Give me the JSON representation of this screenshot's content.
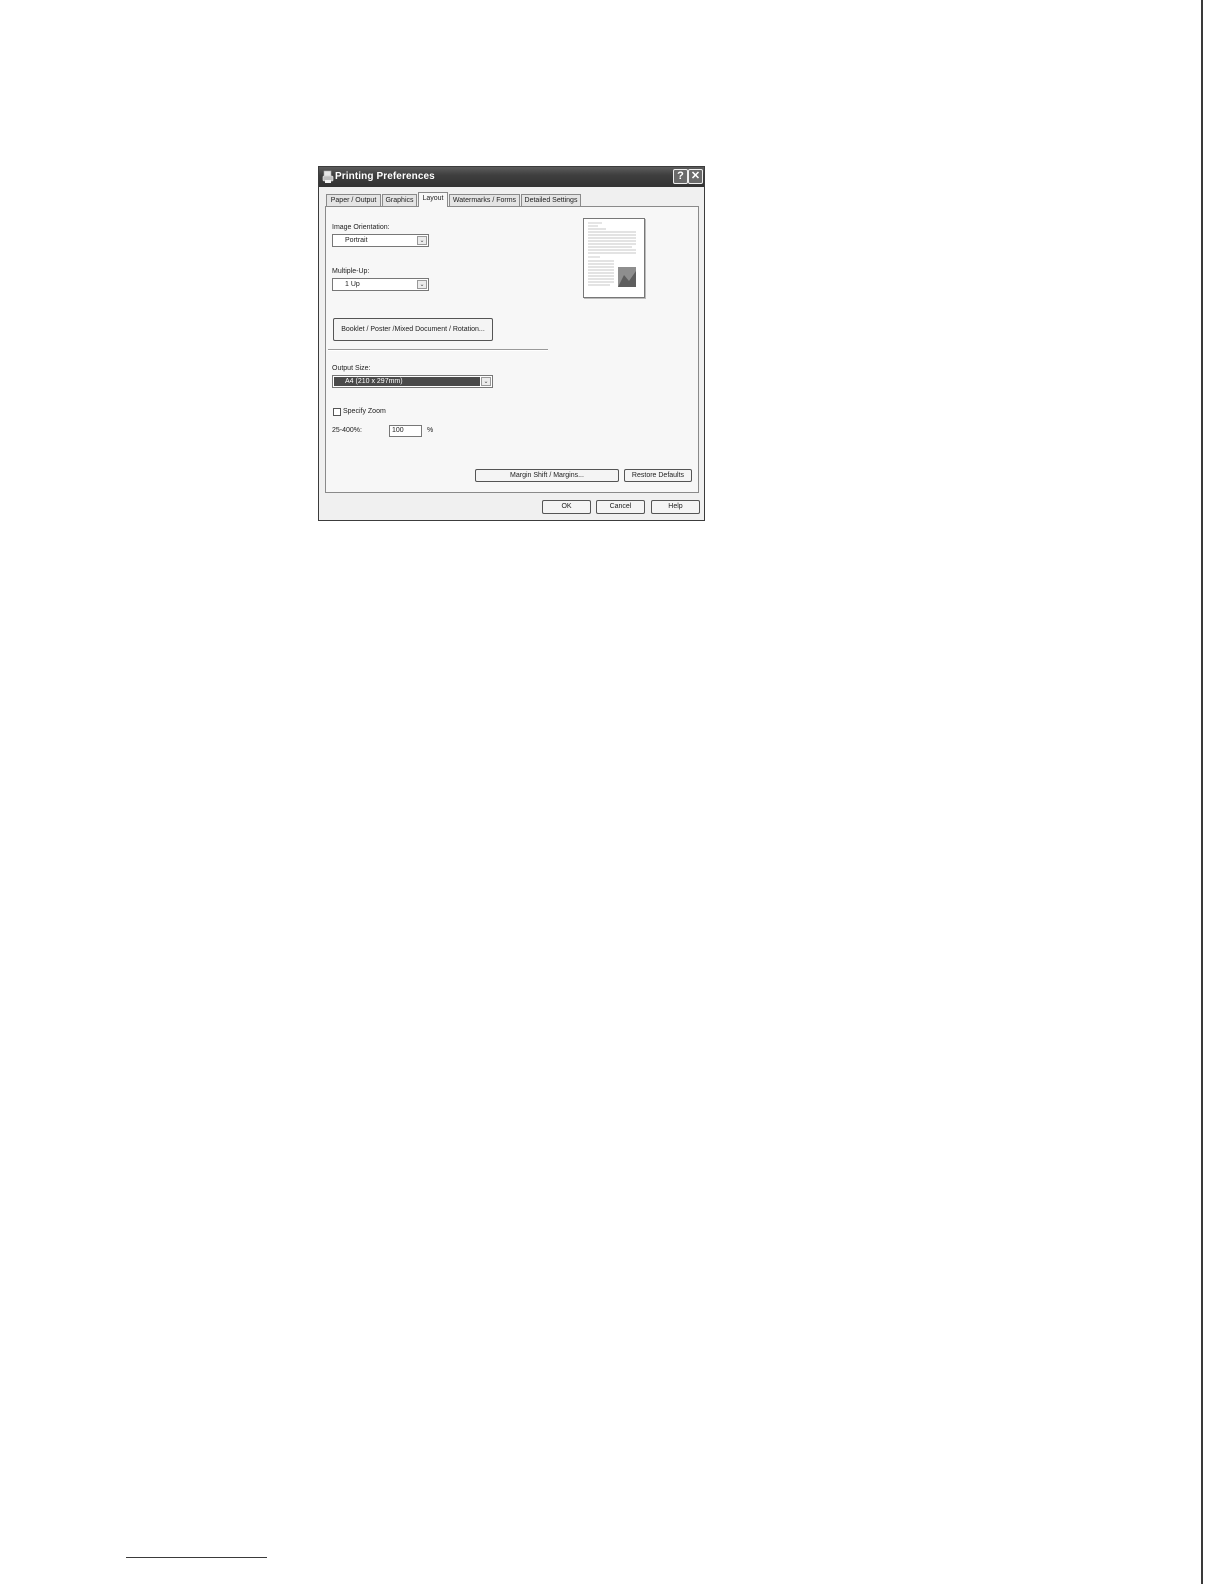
{
  "dialog": {
    "title": "Printing Preferences",
    "help_button": "?",
    "close_button": "✕"
  },
  "tabs": [
    {
      "label": "Paper / Output",
      "active": false
    },
    {
      "label": "Graphics",
      "active": false
    },
    {
      "label": "Layout",
      "active": true
    },
    {
      "label": "Watermarks / Forms",
      "active": false
    },
    {
      "label": "Detailed Settings",
      "active": false
    }
  ],
  "layout": {
    "image_orientation": {
      "label": "Image Orientation:",
      "value": "Portrait"
    },
    "multiple_up": {
      "label": "Multiple-Up:",
      "value": "1 Up"
    },
    "booklet_button": "Booklet / Poster /Mixed Document / Rotation...",
    "output_size": {
      "label": "Output Size:",
      "value": "A4 (210 x 297mm)"
    },
    "specify_zoom": {
      "label": "Specify Zoom",
      "checked": false
    },
    "zoom": {
      "label": "25-400%:",
      "value": "100",
      "unit": "%"
    },
    "margin_button": "Margin Shift / Margins...",
    "restore_button": "Restore Defaults"
  },
  "footer_buttons": {
    "ok": "OK",
    "cancel": "Cancel",
    "help": "Help"
  },
  "colors": {
    "titlebar": "#3f3f3f",
    "selection": "#4a4a4a"
  },
  "icons": {
    "title": "printer-icon",
    "dropdown": "chevron-down-icon"
  }
}
